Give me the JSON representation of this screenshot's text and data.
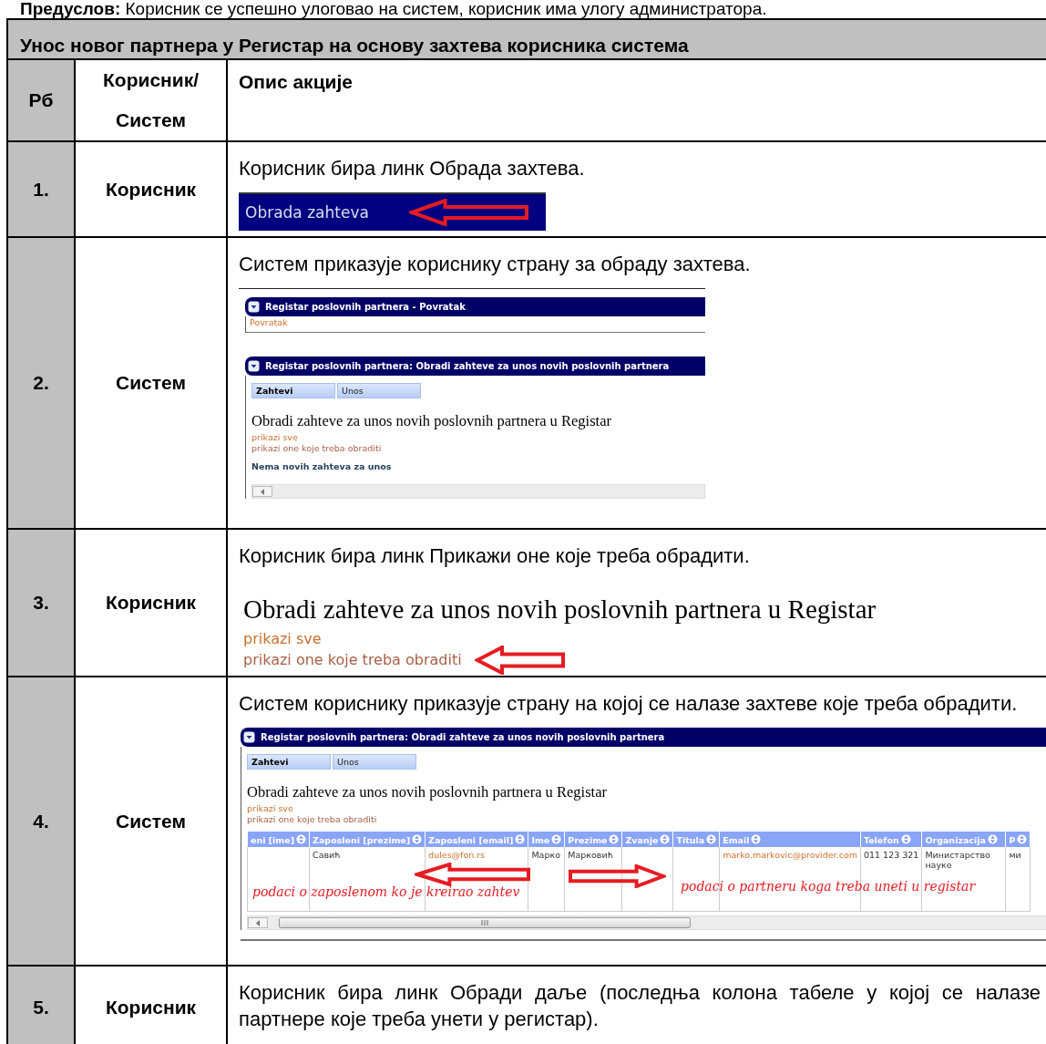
{
  "precondition": "**Предуслов:** Корисник се успешно улоговао на систем, корисник има улогу администратора.",
  "table": {
    "title": "Унос новог партнера у Регистар на основу захтева корисника система",
    "columns": [
      "Рб",
      "Корисник/ Систем",
      "Опис акције"
    ],
    "rows": [
      {
        "number": "1.",
        "actor": "Корисник",
        "description": "Корисник бира линк Обрада захтева.",
        "screenshot": {
          "kind": "menu-link",
          "label": "Obrada zahteva"
        }
      },
      {
        "number": "2.",
        "actor": "Систем",
        "description": "Систем приказује кориснику страну за обраду захтева.",
        "screenshot": {
          "kind": "page",
          "panels": [
            {
              "title": "Registar poslovnih partnera - Povratak",
              "link": "Povratak"
            },
            {
              "title": "Registar poslovnih partnera: Obradi zahteve za unos novih poslovnih partnera",
              "tabs": [
                {
                  "label": "Zahtevi",
                  "selected": true
                },
                {
                  "label": "Unos",
                  "selected": false
                }
              ],
              "heading": "Obradi zahteve za unos novih poslovnih partnera u Registar",
              "links": [
                {
                  "label": "prikazi sve",
                  "pointed": false
                },
                {
                  "label": "prikazi one koje treba obraditi",
                  "pointed": false
                }
              ],
              "message": "Nema novih zahteva za unos"
            }
          ]
        }
      },
      {
        "number": "3.",
        "actor": "Корисник",
        "description": "Корисник бира линк Прикажи оне које треба обрадити.",
        "screenshot": {
          "kind": "links",
          "heading": "Obradi zahteve za unos novih poslovnih partnera u Registar",
          "links": [
            {
              "label": "prikazi sve",
              "pointed": false
            },
            {
              "label": "prikazi one koje treba obraditi",
              "pointed": true
            }
          ]
        }
      },
      {
        "number": "4.",
        "actor": "Систем",
        "description": "Систем кориснику приказује страну на којој се налазе захтеве које треба обрадити.",
        "screenshot": {
          "kind": "page",
          "wide": true,
          "panels": [
            {
              "title": "Registar poslovnih partnera: Obradi zahteve za unos novih poslovnih partnera",
              "tabs": [
                {
                  "label": "Zahtevi",
                  "selected": true
                },
                {
                  "label": "Unos",
                  "selected": false
                }
              ],
              "heading": "Obradi zahteve za unos novih poslovnih partnera u Registar",
              "links": [
                {
                  "label": "prikazi sve",
                  "pointed": false
                },
                {
                  "label": "prikazi one koje treba obraditi",
                  "pointed": false
                }
              ],
              "grid": {
                "columns": [
                  {
                    "label": "eni [ime]"
                  },
                  {
                    "label": "Zaposleni [prezime]",
                    "value": "Савић",
                    "link": false
                  },
                  {
                    "label": "Zaposleni [email]",
                    "value": "dules@fon.rs",
                    "link": true
                  },
                  {
                    "label": "Ime",
                    "value": "Марко",
                    "link": false
                  },
                  {
                    "label": "Prezime",
                    "value": "Марковић",
                    "link": false
                  },
                  {
                    "label": "Zvanje"
                  },
                  {
                    "label": "Titula"
                  },
                  {
                    "label": "Email",
                    "value": "marko.markovic@provider.com",
                    "link": true
                  },
                  {
                    "label": "Telefon",
                    "value": "011 123 321",
                    "link": false
                  },
                  {
                    "label": "Organizacija",
                    "value": "Министарство науке",
                    "link": false
                  },
                  {
                    "label": "P",
                    "value": "ми",
                    "link": false
                  }
                ],
                "annotations": [
                  "podaci o zaposlenom ko je kreirao zahtev",
                  "podaci o partneru koga treba uneti u registar"
                ]
              }
            }
          ]
        }
      },
      {
        "number": "5.",
        "actor": "Корисник",
        "description": "Корисник бира линк Обради даље (последња колона табеле у којој се налазе партнере које треба унети у регистар)."
      }
    ]
  }
}
